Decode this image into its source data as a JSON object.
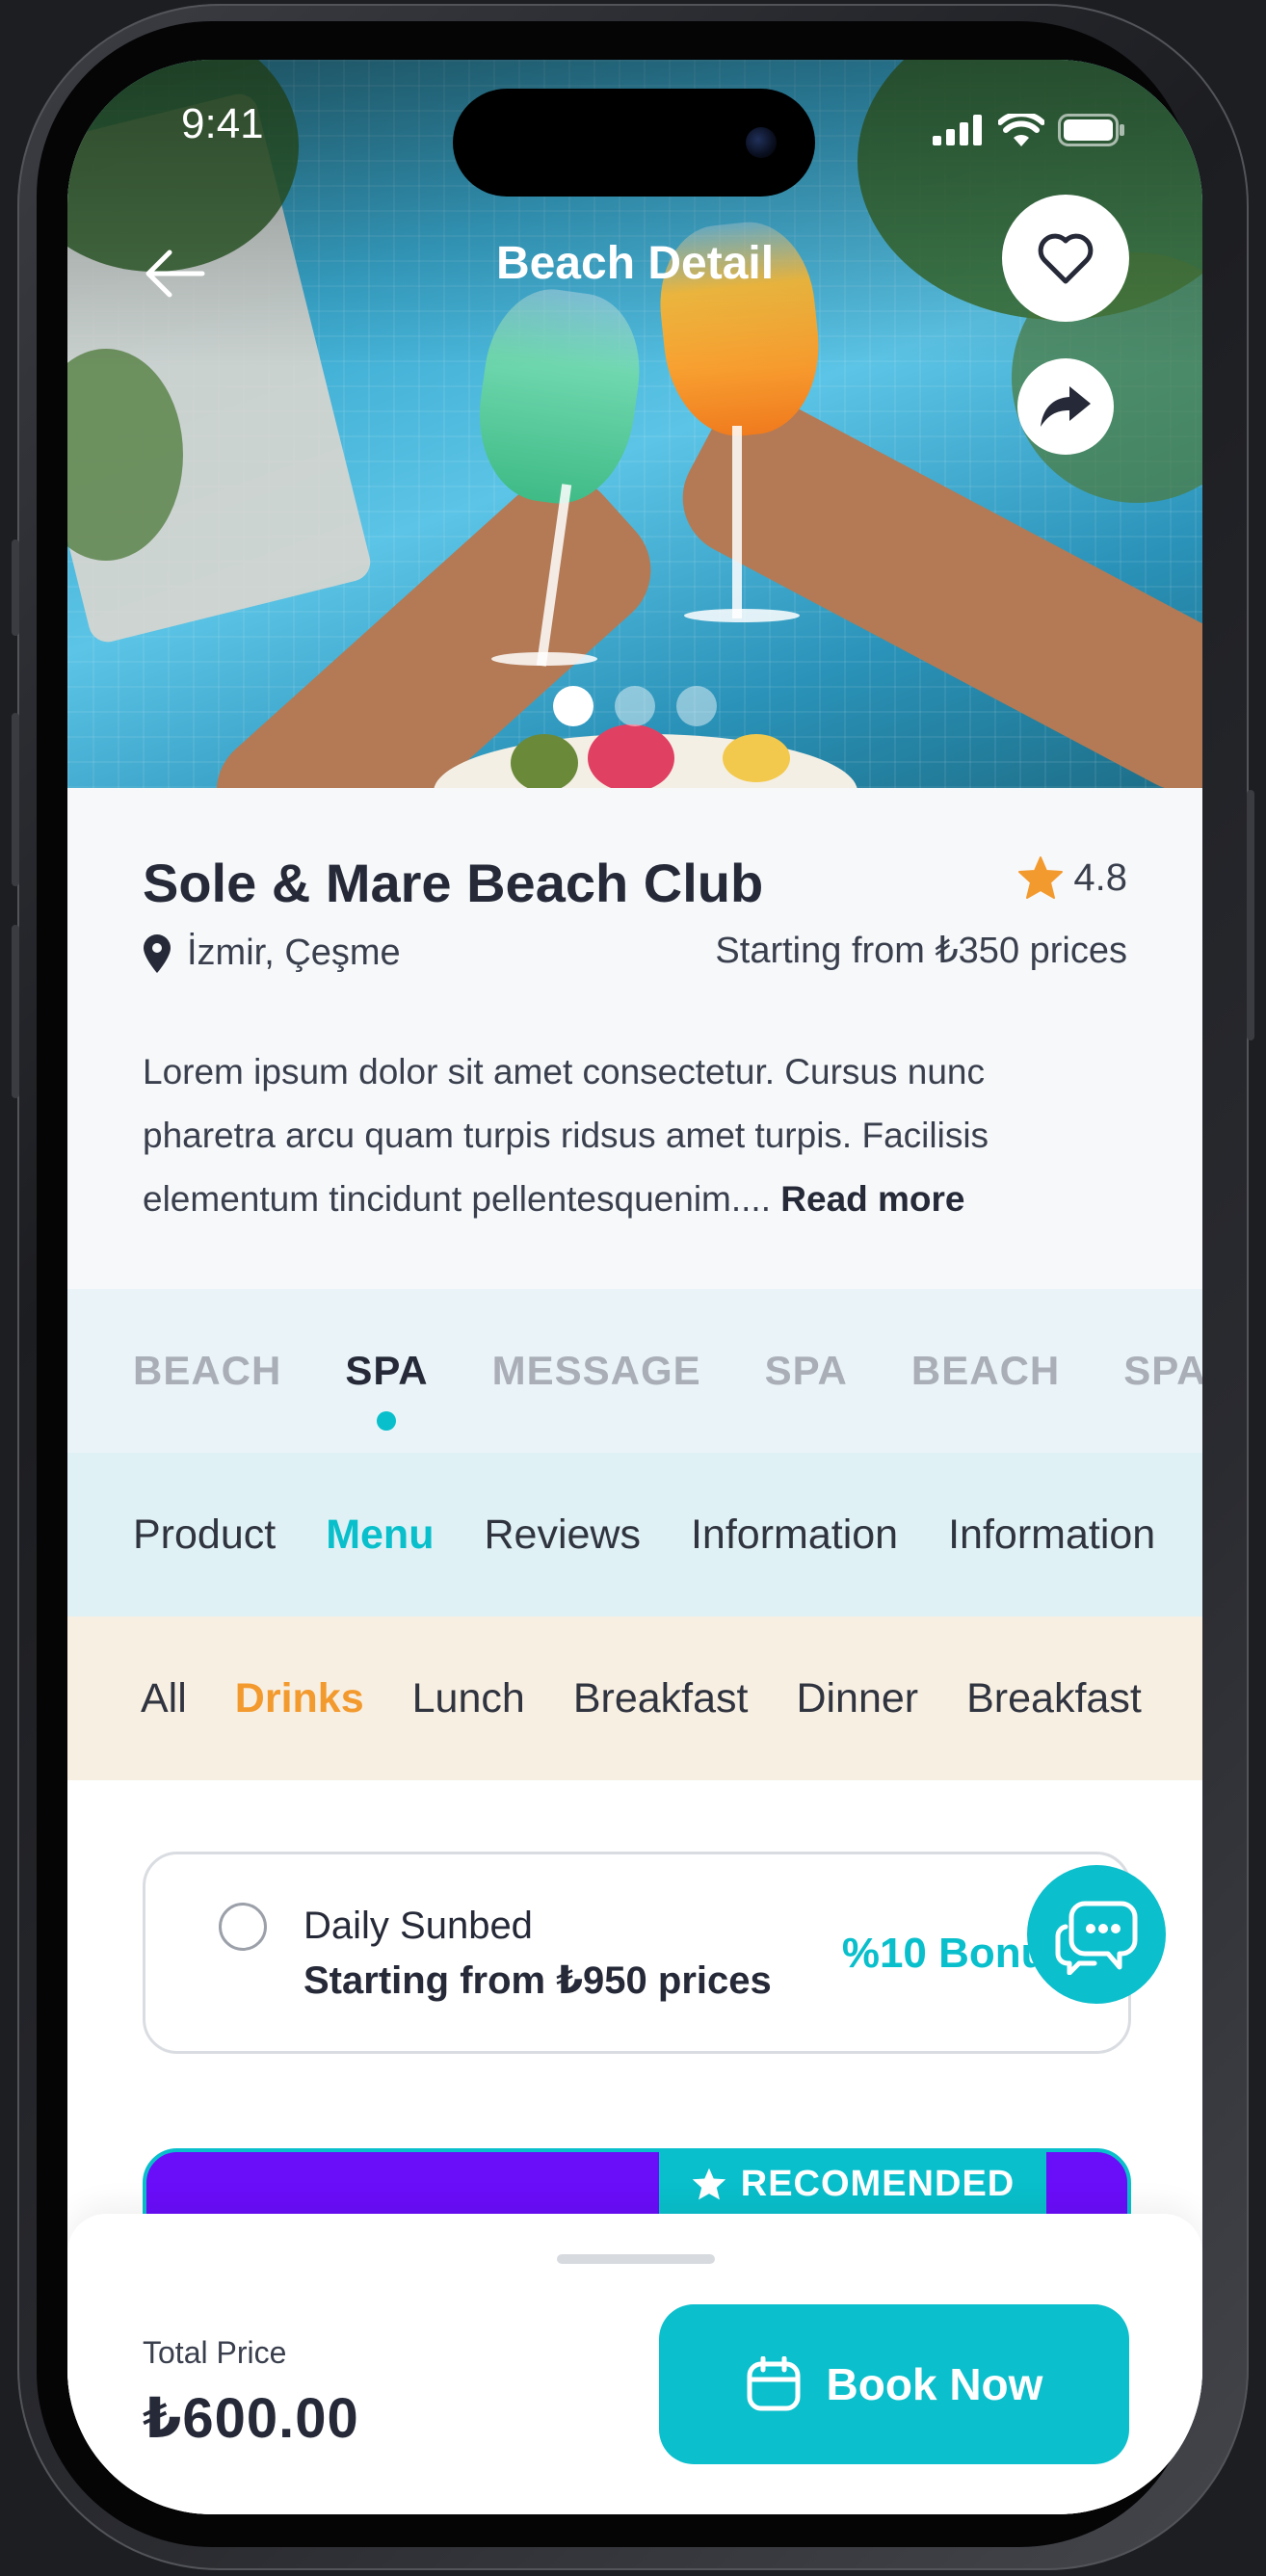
{
  "status_bar": {
    "time": "9:41"
  },
  "header": {
    "title": "Beach Detail"
  },
  "carousel": {
    "pages": 3,
    "active_index": 0
  },
  "venue": {
    "name": "Sole & Mare Beach Club",
    "rating": "4.8",
    "location": "İzmir, Çeşme",
    "price_from": "Starting from ₺350 prices",
    "description": "Lorem ipsum dolor sit amet consectetur. Cursus nunc pharetra arcu quam turpis ridsus amet turpis. Facilisis elementum tincidunt pellentesquenim....",
    "read_more": "Read more"
  },
  "category_tabs": [
    {
      "label": "BEACH",
      "active": false
    },
    {
      "label": "SPA",
      "active": true
    },
    {
      "label": "MESSAGE",
      "active": false
    },
    {
      "label": "SPA",
      "active": false
    },
    {
      "label": "BEACH",
      "active": false
    },
    {
      "label": "SPA",
      "active": false
    }
  ],
  "section_tabs": [
    {
      "label": "Product",
      "active": false
    },
    {
      "label": "Menu",
      "active": true
    },
    {
      "label": "Reviews",
      "active": false
    },
    {
      "label": "Information",
      "active": false
    },
    {
      "label": "Information",
      "active": false
    }
  ],
  "food_tabs": [
    {
      "label": "All",
      "active": false
    },
    {
      "label": "Drinks",
      "active": true
    },
    {
      "label": "Lunch",
      "active": false
    },
    {
      "label": "Breakfast",
      "active": false
    },
    {
      "label": "Dinner",
      "active": false
    },
    {
      "label": "Breakfast",
      "active": false
    }
  ],
  "options": [
    {
      "title": "Daily Sunbed",
      "price": "Starting from ₺950 prices",
      "bonus": "%10 Bonus",
      "selected": false
    }
  ],
  "recommended": {
    "badge": "RECOMENDED"
  },
  "footer": {
    "total_label": "Total Price",
    "total_value": "₺600.00",
    "book_label": "Book Now"
  },
  "colors": {
    "accent": "#09BFCB",
    "drinks_active": "#F39A2E",
    "recommended_bg": "#6A0DF9",
    "star": "#F39A2E"
  }
}
